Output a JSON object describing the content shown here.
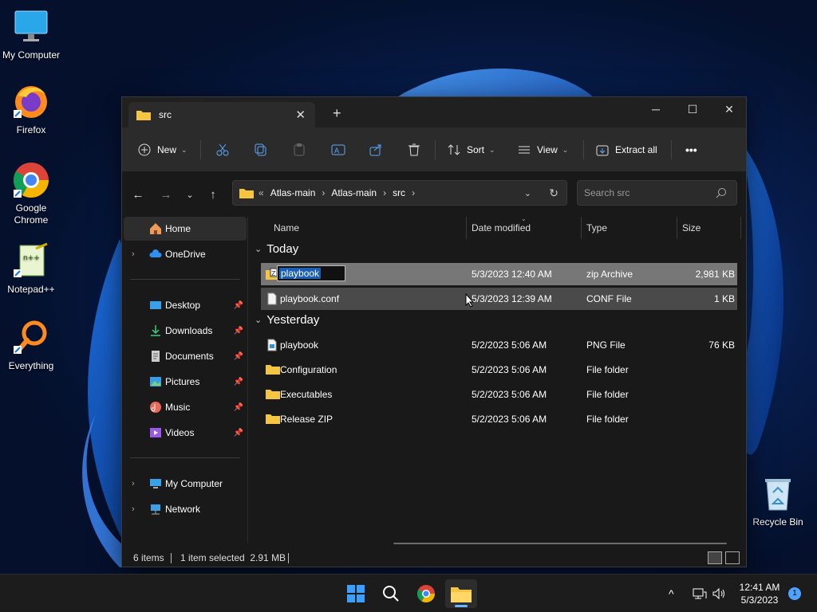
{
  "desktop": {
    "icons": [
      {
        "label": "My Computer",
        "icon": "monitor-icon"
      },
      {
        "label": "Firefox",
        "icon": "firefox-icon"
      },
      {
        "label": "Google Chrome",
        "icon": "chrome-icon"
      },
      {
        "label": "Notepad++",
        "icon": "notepadpp-icon"
      },
      {
        "label": "Everything",
        "icon": "search-magnifier-icon"
      },
      {
        "label": "Recycle Bin",
        "icon": "recycle-bin-icon"
      }
    ]
  },
  "window": {
    "tab_title": "src",
    "toolbar": {
      "new_label": "New",
      "sort_label": "Sort",
      "view_label": "View",
      "extract_label": "Extract all",
      "more_label": "•••"
    },
    "breadcrumb": {
      "overflow": "«",
      "items": [
        "Atlas-main",
        "Atlas-main",
        "src"
      ]
    },
    "search_placeholder": "Search src",
    "nav": {
      "home": "Home",
      "onedrive": "OneDrive",
      "desktop": "Desktop",
      "downloads": "Downloads",
      "documents": "Documents",
      "pictures": "Pictures",
      "music": "Music",
      "videos": "Videos",
      "my_computer": "My Computer",
      "network": "Network"
    },
    "columns": {
      "name": "Name",
      "date": "Date modified",
      "type": "Type",
      "size": "Size"
    },
    "groups": {
      "today": "Today",
      "yesterday": "Yesterday"
    },
    "files": [
      {
        "name": "playbook",
        "date": "5/3/2023 12:40 AM",
        "type": "zip Archive",
        "size": "2,981 KB",
        "renaming": true
      },
      {
        "name": "playbook.conf",
        "date": "5/3/2023 12:39 AM",
        "type": "CONF File",
        "size": "1 KB"
      },
      {
        "name": "playbook",
        "date": "5/2/2023 5:06 AM",
        "type": "PNG File",
        "size": "76 KB"
      },
      {
        "name": "Configuration",
        "date": "5/2/2023 5:06 AM",
        "type": "File folder",
        "size": ""
      },
      {
        "name": "Executables",
        "date": "5/2/2023 5:06 AM",
        "type": "File folder",
        "size": ""
      },
      {
        "name": "Release ZIP",
        "date": "5/2/2023 5:06 AM",
        "type": "File folder",
        "size": ""
      }
    ],
    "status": {
      "count": "6 items",
      "selection": "1 item selected  2.91 MB"
    }
  },
  "taskbar": {
    "time": "12:41 AM",
    "date": "5/3/2023",
    "notifications": "1"
  }
}
